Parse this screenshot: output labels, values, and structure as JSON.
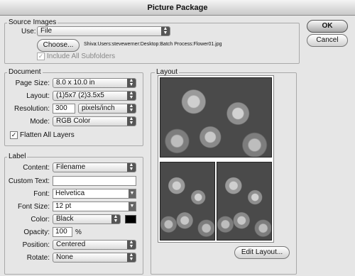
{
  "window": {
    "title": "Picture Package"
  },
  "buttons": {
    "ok": "OK",
    "cancel": "Cancel",
    "choose": "Choose...",
    "edit_layout": "Edit Layout..."
  },
  "source": {
    "group_label": "Source Images",
    "use_label": "Use:",
    "use_value": "File",
    "file_path": "Shiva:Users:stevewerner:Desktop:Batch Process:Flower01.jpg",
    "include_subfolders": "Include All Subfolders"
  },
  "document": {
    "group_label": "Document",
    "page_size_label": "Page Size:",
    "page_size": "8.0 x 10.0 in",
    "layout_label": "Layout:",
    "layout": "(1)5x7 (2)3.5x5",
    "resolution_label": "Resolution:",
    "resolution": "300",
    "resolution_unit": "pixels/inch",
    "mode_label": "Mode:",
    "mode": "RGB Color",
    "flatten": "Flatten All Layers"
  },
  "label": {
    "group_label": "Label",
    "content_label": "Content:",
    "content": "Filename",
    "custom_text_label": "Custom Text:",
    "custom_text": "",
    "font_label": "Font:",
    "font": "Helvetica",
    "font_size_label": "Font Size:",
    "font_size": "12 pt",
    "color_label": "Color:",
    "color": "Black",
    "opacity_label": "Opacity:",
    "opacity": "100",
    "opacity_unit": "%",
    "position_label": "Position:",
    "position": "Centered",
    "rotate_label": "Rotate:",
    "rotate": "None"
  },
  "layout_panel": {
    "group_label": "Layout"
  },
  "colors": {
    "label_color": "#000000"
  }
}
